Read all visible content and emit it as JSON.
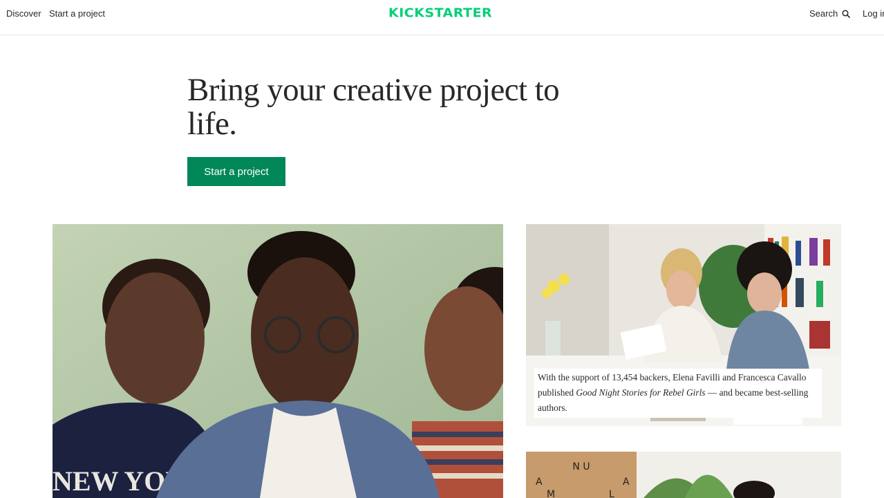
{
  "nav": {
    "discover": "Discover",
    "start_project": "Start a project",
    "logo": "KICKSTARTER",
    "search": "Search",
    "login": "Log in"
  },
  "hero": {
    "title": "Bring your creative project to life.",
    "cta": "Start a project"
  },
  "story": {
    "caption_prefix": "With the support of 13,454 backers, Elena Favilli and Francesca Cavallo published ",
    "caption_title": "Good Night Stories for Rebel Girls",
    "caption_suffix": " — and became best-selling authors."
  },
  "colors": {
    "brand_green": "#05ce78",
    "cta_green": "#028858",
    "text": "#282828"
  }
}
